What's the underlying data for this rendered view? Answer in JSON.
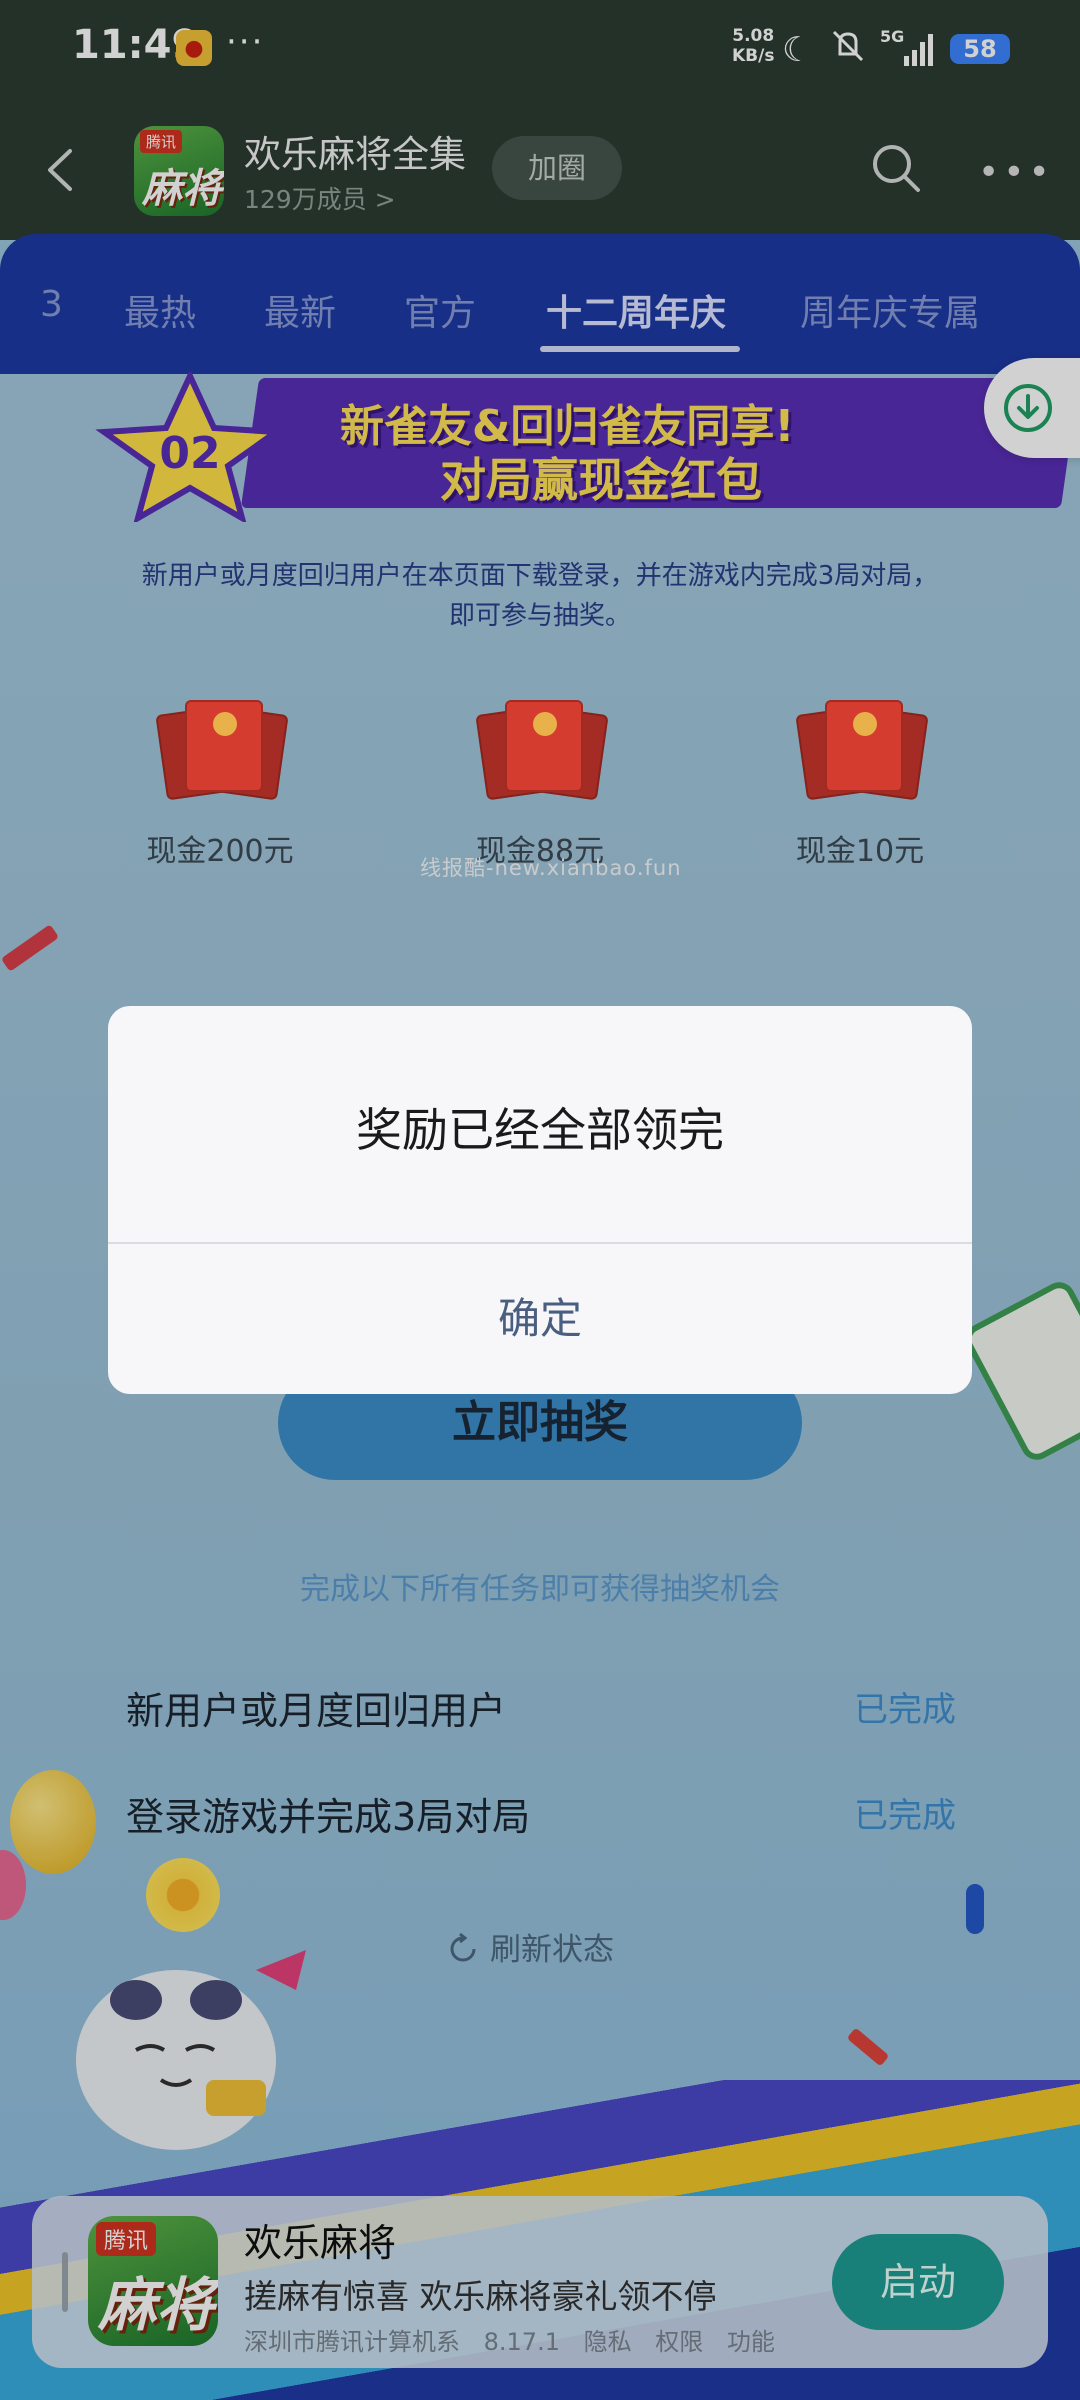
{
  "status_bar": {
    "time": "11:49",
    "dots": "···",
    "net_speed_value": "5.08",
    "net_speed_unit": "KB/s",
    "network": "5G",
    "battery": "58"
  },
  "header": {
    "app_title": "欢乐麻将全集",
    "member_count": "129万成员 >",
    "join_label": "加圈",
    "logo_tag": "腾讯",
    "logo_text": "麻将"
  },
  "tabs": [
    {
      "label": "3"
    },
    {
      "label": "最热"
    },
    {
      "label": "最新"
    },
    {
      "label": "官方"
    },
    {
      "label": "十二周年庆"
    },
    {
      "label": "周年庆专属"
    }
  ],
  "banner": {
    "badge": "02",
    "line1": "新雀友&回归雀友同享!",
    "line2": "对局赢现金红包"
  },
  "description": "新用户或月度回归用户在本页面下载登录，并在游戏内完成3局对局，即可参与抽奖。",
  "prizes": [
    {
      "label": "现金200元"
    },
    {
      "label": "现金88元"
    },
    {
      "label": "现金10元"
    }
  ],
  "watermark": "线报酷-new.xianbao.fun",
  "draw_button": "立即抽奖",
  "task_hint": "完成以下所有任务即可获得抽奖机会",
  "tasks": [
    {
      "title": "新用户或月度回归用户",
      "status": "已完成"
    },
    {
      "title": "登录游戏并完成3局对局",
      "status": "已完成"
    }
  ],
  "refresh_label": "刷新状态",
  "dialog": {
    "message": "奖励已经全部领完",
    "confirm": "确定"
  },
  "app_card": {
    "logo_tag": "腾讯",
    "logo_text": "麻将",
    "title": "欢乐麻将",
    "slogan": "搓麻有惊喜 欢乐麻将豪礼领不停",
    "developer": "深圳市腾讯计算机系",
    "version": "8.17.1",
    "privacy": "隐私",
    "permissions": "权限",
    "features": "功能",
    "start_label": "启动"
  },
  "colors": {
    "header_bg": "#2c3c33",
    "tab_bar_bg": "#1e3aa6",
    "content_bg": "#a5c9de",
    "dialog_confirm": "#4a5f80",
    "task_done": "#3f8fcf",
    "start_button": "#1f9d94"
  }
}
